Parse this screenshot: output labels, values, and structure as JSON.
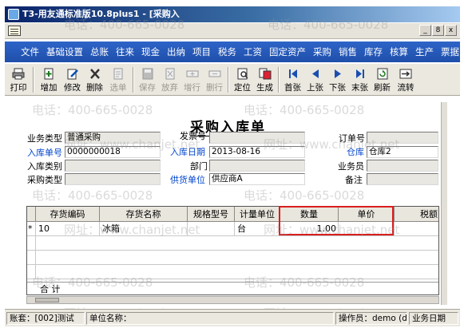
{
  "window": {
    "title": "T3-用友通标准版10.8plus1 - [采购入"
  },
  "window_buttons": [
    "_",
    "8",
    "x"
  ],
  "menu": [
    "文件",
    "基础设置",
    "总账",
    "往来",
    "现金",
    "出纳",
    "项目",
    "税务",
    "工资",
    "固定资产",
    "采购",
    "销售",
    "库存",
    "核算",
    "生产",
    "票据"
  ],
  "toolbar": [
    {
      "label": "打印",
      "icon": "printer-icon",
      "enabled": true
    },
    {
      "label": "增加",
      "icon": "add-icon",
      "enabled": true
    },
    {
      "label": "修改",
      "icon": "edit-icon",
      "enabled": true
    },
    {
      "label": "删除",
      "icon": "delete-icon",
      "enabled": true
    },
    {
      "label": "选单",
      "icon": "select-icon",
      "enabled": false
    },
    {
      "label": "保存",
      "icon": "save-icon",
      "enabled": false
    },
    {
      "label": "放弃",
      "icon": "discard-icon",
      "enabled": false
    },
    {
      "label": "增行",
      "icon": "add-row-icon",
      "enabled": false
    },
    {
      "label": "删行",
      "icon": "delete-row-icon",
      "enabled": false
    },
    {
      "label": "定位",
      "icon": "locate-icon",
      "enabled": true
    },
    {
      "label": "生成",
      "icon": "generate-icon",
      "enabled": true
    },
    {
      "label": "首张",
      "icon": "first-icon",
      "enabled": true
    },
    {
      "label": "上张",
      "icon": "prev-icon",
      "enabled": true
    },
    {
      "label": "下张",
      "icon": "next-icon",
      "enabled": true
    },
    {
      "label": "末张",
      "icon": "last-icon",
      "enabled": true
    },
    {
      "label": "刷新",
      "icon": "refresh-icon",
      "enabled": true
    },
    {
      "label": "流转",
      "icon": "flow-icon",
      "enabled": true
    }
  ],
  "form": {
    "title": "采购入库单",
    "fields": {
      "business_type": {
        "label": "业务类型",
        "value": "普通采购"
      },
      "invoice_no": {
        "label": "发票号",
        "value": ""
      },
      "order_no": {
        "label": "订单号",
        "value": ""
      },
      "receipt_no": {
        "label": "入库单号",
        "value": "0000000018"
      },
      "receipt_date": {
        "label": "入库日期",
        "value": "2013-08-16"
      },
      "warehouse": {
        "label": "仓库",
        "value": "仓库2"
      },
      "receipt_category": {
        "label": "入库类别",
        "value": ""
      },
      "department": {
        "label": "部门",
        "value": ""
      },
      "salesperson": {
        "label": "业务员",
        "value": ""
      },
      "purchase_type": {
        "label": "采购类型",
        "value": ""
      },
      "supplier": {
        "label": "供货单位",
        "value": "供应商A"
      },
      "remarks": {
        "label": "备注",
        "value": ""
      }
    }
  },
  "grid": {
    "columns": [
      "存货编码",
      "存货名称",
      "规格型号",
      "计量单位",
      "数量",
      "单价",
      "税额"
    ],
    "rows": [
      {
        "marker": "*",
        "code": "10",
        "name": "冰箱",
        "spec": "",
        "unit": "台",
        "qty": "1.00",
        "price": "",
        "tax": ""
      }
    ],
    "total_label": "合  计"
  },
  "status": {
    "account": "账套：[002]测试",
    "unit_name": "单位名称：",
    "operator": "操作员：demo (d",
    "business_date": "业务日期"
  },
  "watermarks": [
    "电话：400-665-0028",
    "网址：www.chanjet.net"
  ],
  "colors": {
    "menu_bg": "#2456b8",
    "title_bg": "#0a246a",
    "highlight": "#d91e1e",
    "blue_label": "#0044cc"
  }
}
